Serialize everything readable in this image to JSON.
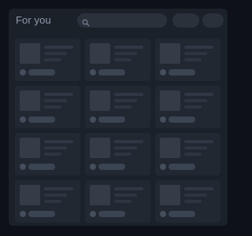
{
  "header": {
    "title": "For you",
    "search": {
      "placeholder": "",
      "icon": "search-icon"
    }
  },
  "colors": {
    "page_background": "#0e1117",
    "panel_background": "#1b2129",
    "card_background": "#212832",
    "placeholder": "#343c48",
    "title_text": "#8e9aab"
  },
  "feed": {
    "columns": 3,
    "rows": 4,
    "card_count": 12
  }
}
